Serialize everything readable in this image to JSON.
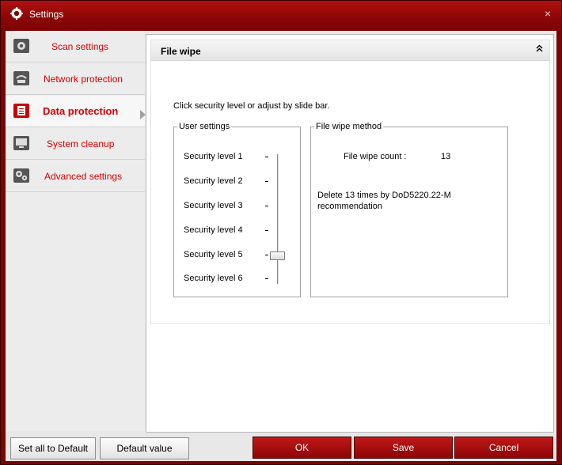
{
  "window": {
    "title": "Settings",
    "close_glyph": "×"
  },
  "sidebar": {
    "items": [
      {
        "label": "Scan settings",
        "icon": "gear-icon"
      },
      {
        "label": "Network protection",
        "icon": "wifi-icon"
      },
      {
        "label": "Data protection",
        "icon": "document-icon",
        "active": true
      },
      {
        "label": "System cleanup",
        "icon": "monitor-icon"
      },
      {
        "label": "Advanced settings",
        "icon": "gears-icon"
      }
    ]
  },
  "panel": {
    "title": "File wipe",
    "collapse_glyph": "⌃",
    "instruction": "Click security level or adjust by slide bar.",
    "user_settings": {
      "legend": "User settings",
      "levels": [
        "Security level 1",
        "Security level 2",
        "Security level 3",
        "Security level 4",
        "Security level 5",
        "Security level 6"
      ],
      "selected_level": 5
    },
    "wipe_method": {
      "legend": "File wipe method",
      "count_label": "File wipe count :",
      "count_value": "13",
      "description": "Delete 13 times by DoD5220.22-M recommendation"
    }
  },
  "footer": {
    "set_all_default": "Set all to Default",
    "default_value": "Default value",
    "ok": "OK",
    "save": "Save",
    "cancel": "Cancel"
  },
  "colors": {
    "accent": "#d40000",
    "titlebar": "#a00c0c",
    "button_red": "#a00e0e"
  }
}
